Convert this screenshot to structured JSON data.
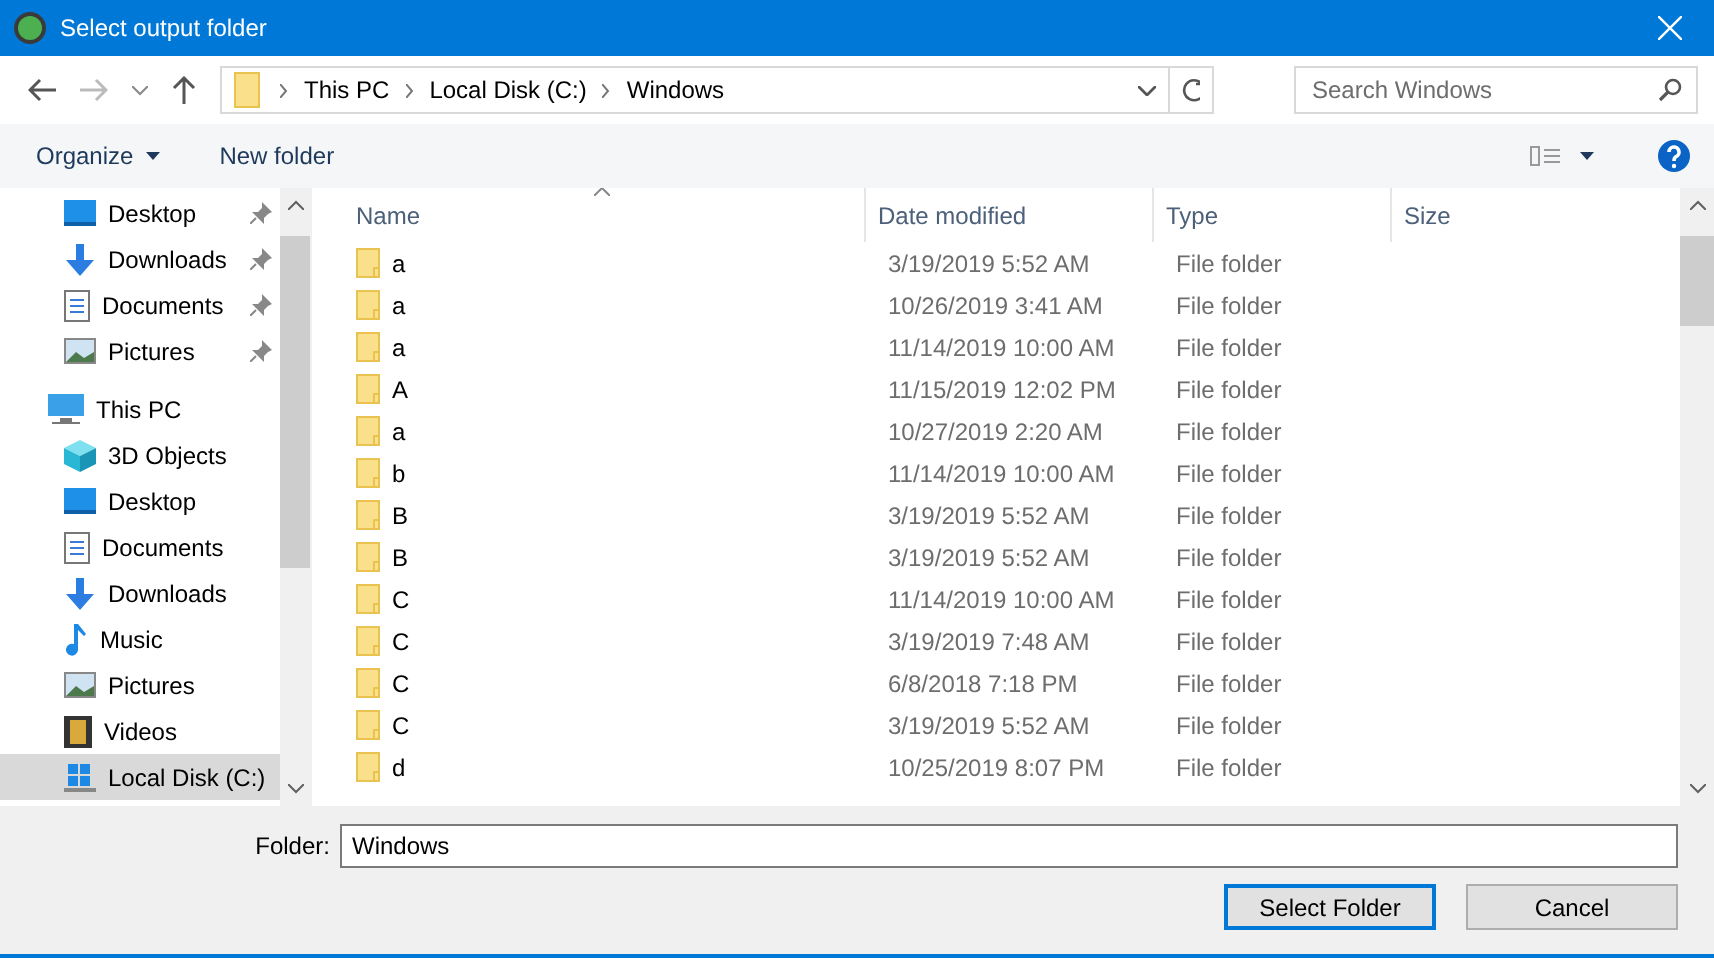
{
  "window": {
    "title": "Select output folder"
  },
  "address": {
    "segments": [
      "This PC",
      "Local Disk (C:)",
      "Windows"
    ]
  },
  "search": {
    "placeholder": "Search Windows"
  },
  "toolbar": {
    "organize": "Organize",
    "new_folder": "New folder"
  },
  "nav_pane": {
    "items": [
      {
        "label": "Desktop",
        "kind": "desktop",
        "pinned": true,
        "selected": false
      },
      {
        "label": "Downloads",
        "kind": "downloads",
        "pinned": true,
        "selected": false
      },
      {
        "label": "Documents",
        "kind": "documents",
        "pinned": true,
        "selected": false
      },
      {
        "label": "Pictures",
        "kind": "pictures",
        "pinned": true,
        "selected": false
      },
      {
        "label": "This PC",
        "kind": "pc",
        "selected": false,
        "children": [
          {
            "label": "3D Objects",
            "kind": "objects3d",
            "selected": false
          },
          {
            "label": "Desktop",
            "kind": "desktop",
            "selected": false
          },
          {
            "label": "Documents",
            "kind": "documents",
            "selected": false
          },
          {
            "label": "Downloads",
            "kind": "downloads",
            "selected": false
          },
          {
            "label": "Music",
            "kind": "music",
            "selected": false
          },
          {
            "label": "Pictures",
            "kind": "pictures",
            "selected": false
          },
          {
            "label": "Videos",
            "kind": "videos",
            "selected": false
          },
          {
            "label": "Local Disk (C:)",
            "kind": "disk",
            "selected": true
          }
        ]
      }
    ]
  },
  "file_list": {
    "columns": [
      "Name",
      "Date modified",
      "Type",
      "Size"
    ],
    "rows": [
      {
        "name": "a",
        "date_modified": "3/19/2019 5:52 AM",
        "type": "File folder"
      },
      {
        "name": "a",
        "date_modified": "10/26/2019 3:41 AM",
        "type": "File folder"
      },
      {
        "name": "a",
        "date_modified": "11/14/2019 10:00 AM",
        "type": "File folder"
      },
      {
        "name": "A",
        "date_modified": "11/15/2019 12:02 PM",
        "type": "File folder"
      },
      {
        "name": "a",
        "date_modified": "10/27/2019 2:20 AM",
        "type": "File folder"
      },
      {
        "name": "b",
        "date_modified": "11/14/2019 10:00 AM",
        "type": "File folder"
      },
      {
        "name": "B",
        "date_modified": "3/19/2019 5:52 AM",
        "type": "File folder"
      },
      {
        "name": "B",
        "date_modified": "3/19/2019 5:52 AM",
        "type": "File folder"
      },
      {
        "name": "C",
        "date_modified": "11/14/2019 10:00 AM",
        "type": "File folder"
      },
      {
        "name": "C",
        "date_modified": "3/19/2019 7:48 AM",
        "type": "File folder"
      },
      {
        "name": "C",
        "date_modified": "6/8/2018 7:18 PM",
        "type": "File folder"
      },
      {
        "name": "C",
        "date_modified": "3/19/2019 5:52 AM",
        "type": "File folder"
      },
      {
        "name": "d",
        "date_modified": "10/25/2019 8:07 PM",
        "type": "File folder"
      }
    ]
  },
  "folder_field": {
    "label": "Folder:",
    "value": "Windows"
  },
  "buttons": [
    {
      "label": "Select Folder",
      "kind": "primary"
    },
    {
      "label": "Cancel",
      "kind": "normal"
    }
  ]
}
